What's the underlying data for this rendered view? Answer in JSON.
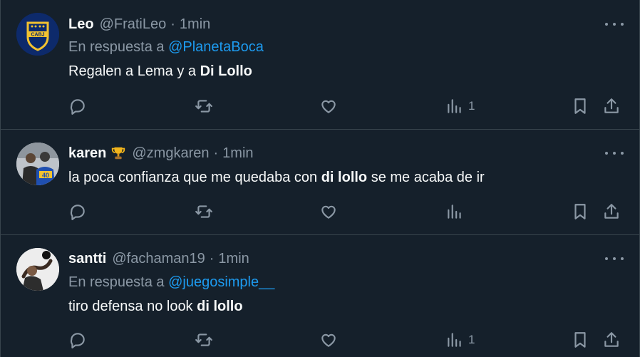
{
  "tweets": [
    {
      "name": "Leo",
      "handle": "@FratiLeo",
      "dot": "·",
      "time": "1min",
      "reply_prefix": "En respuesta a",
      "reply_mention": "@PlanetaBoca",
      "text_plain": "Regalen a Lema y a ",
      "text_bold": "Di Lollo",
      "text_after": "",
      "views": "1",
      "avatar_text": "CABJ"
    },
    {
      "name": "karen",
      "emoji": "trophy",
      "handle": "@zmgkaren",
      "dot": "·",
      "time": "1min",
      "text_plain": "la poca confianza que me quedaba con ",
      "text_bold": "di lollo",
      "text_after": " se me acaba de ir",
      "views": "",
      "avatar_text": "40"
    },
    {
      "name": "santti",
      "handle": "@fachaman19",
      "dot": "·",
      "time": "1min",
      "reply_prefix": "En respuesta a",
      "reply_mention": "@juegosimple__",
      "text_plain": "tiro defensa no look ",
      "text_bold": "di lollo",
      "text_after": "",
      "views": "1"
    }
  ],
  "icons": {
    "reply": "reply-icon",
    "retweet": "retweet-icon",
    "like": "like-icon",
    "views": "views-icon",
    "bookmark": "bookmark-icon",
    "share": "share-icon",
    "more": "more-icon"
  },
  "colors": {
    "background": "#15202b",
    "muted": "#8b98a5",
    "link": "#1d9bf0",
    "border": "#38444d"
  }
}
